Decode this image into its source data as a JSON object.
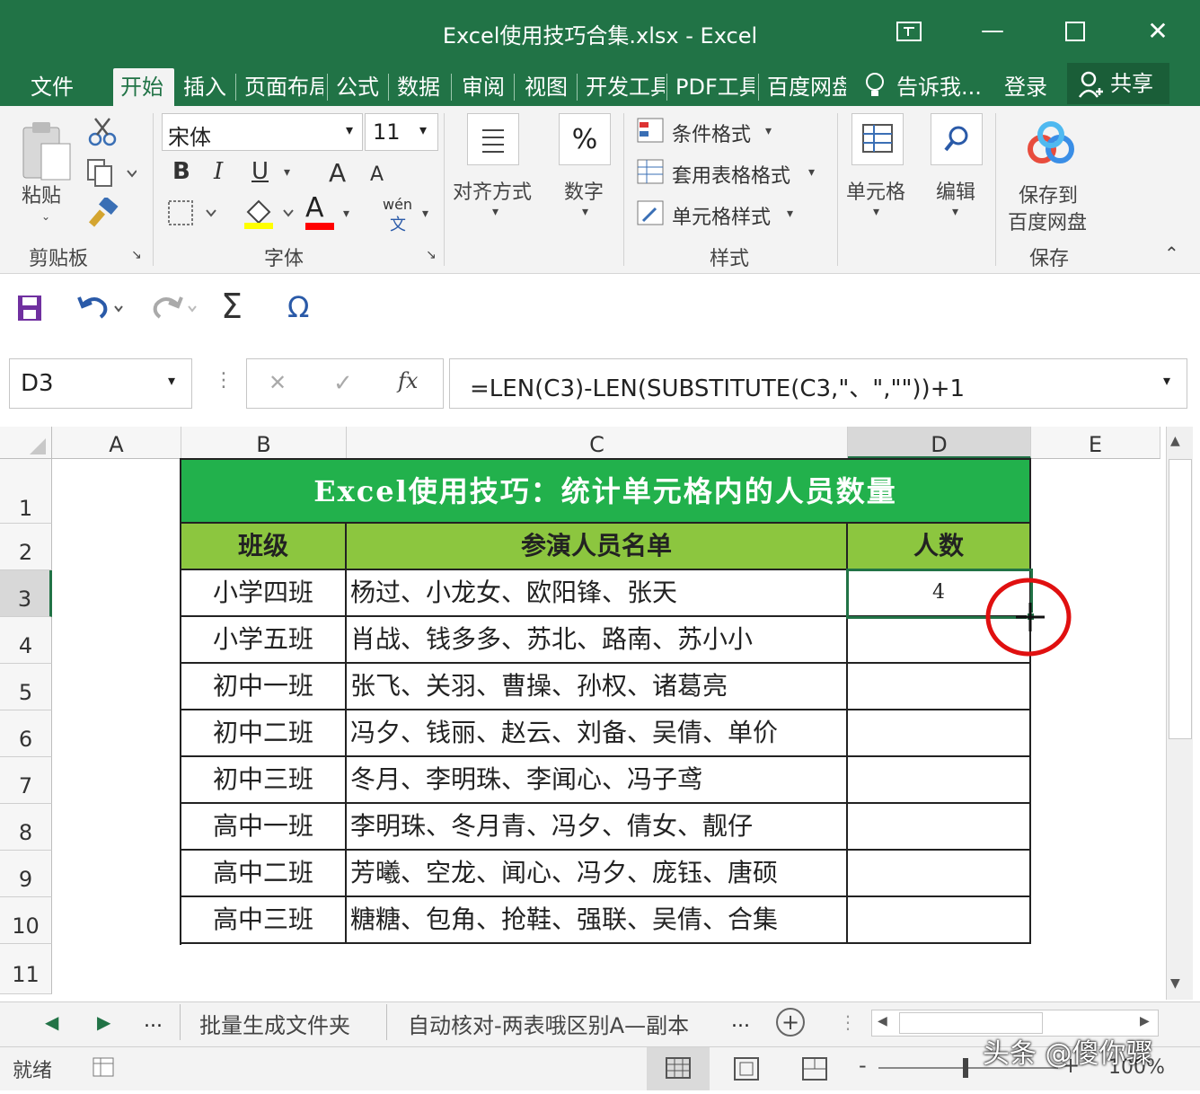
{
  "window": {
    "title": "Excel使用技巧合集.xlsx - Excel",
    "minimize_glyph": "—",
    "close_glyph": "✕"
  },
  "ribbon_tabs": [
    "文件",
    "开始",
    "插入",
    "页面布局",
    "公式",
    "数据",
    "审阅",
    "视图",
    "开发工具",
    "PDF工具",
    "百度网盘"
  ],
  "tell_me": "告诉我...",
  "login": "登录",
  "share": "共享",
  "ribbon": {
    "paste": "粘贴",
    "clipboard": "剪贴板",
    "font_name": "宋体",
    "font_size": "11",
    "bold": "B",
    "italic": "I",
    "underline": "U",
    "grow": "A",
    "shrink": "A",
    "fill_color": "#ffff00",
    "font_color": "#ff0000",
    "font_color_glyph": "A",
    "wen_top": "wén",
    "wen_bottom": "文",
    "font_group": "字体",
    "align": "对齐方式",
    "number": "数字",
    "percent": "%",
    "cond_format": "条件格式",
    "table_format": "套用表格格式",
    "cell_style": "单元格样式",
    "styles_group": "样式",
    "cells": "单元格",
    "edit": "编辑",
    "save_to_1": "保存到",
    "save_to_2": "百度网盘",
    "save_group": "保存"
  },
  "qat": {
    "sigma": "Σ",
    "omega": "Ω"
  },
  "formula_bar": {
    "name_box": "D3",
    "formula": "=LEN(C3)-LEN(SUBSTITUTE(C3,\"、\",\"\"))+1",
    "fx": "fx",
    "dots": "⋮",
    "cancel": "✕",
    "enter": "✓"
  },
  "columns": [
    "A",
    "B",
    "C",
    "D",
    "E"
  ],
  "rows": [
    "1",
    "2",
    "3",
    "4",
    "5",
    "6",
    "7",
    "8",
    "9",
    "10",
    "11"
  ],
  "table": {
    "title": "Excel使用技巧：统计单元格内的人员数量",
    "headers": [
      "班级",
      "参演人员名单",
      "人数"
    ],
    "rows": [
      [
        "小学四班",
        "杨过、小龙女、欧阳锋、张天",
        "4"
      ],
      [
        "小学五班",
        "肖战、钱多多、苏北、路南、苏小小",
        ""
      ],
      [
        "初中一班",
        "张飞、关羽、曹操、孙权、诸葛亮",
        ""
      ],
      [
        "初中二班",
        "冯夕、钱丽、赵云、刘备、吴倩、单价",
        ""
      ],
      [
        "初中三班",
        "冬月、李明珠、李闻心、冯子鸢",
        ""
      ],
      [
        "高中一班",
        "李明珠、冬月青、冯夕、倩女、靓仔",
        ""
      ],
      [
        "高中二班",
        "芳曦、空龙、闻心、冯夕、庞钰、唐硕",
        ""
      ],
      [
        "高中三班",
        "糖糖、包角、抢鞋、强联、吴倩、合集",
        ""
      ]
    ],
    "title_bg": "#22b14c",
    "header_bg": "#8cc63f"
  },
  "sheet_tabs": {
    "more_left": "...",
    "tab1": "批量生成文件夹",
    "tab2": "自动核对-两表哦区别A—副本",
    "more_right": "...",
    "add": "+"
  },
  "status": {
    "ready": "就绪",
    "zoom": "100%",
    "minus": "-",
    "plus": "+"
  },
  "watermark": "头条 @傻你骤"
}
